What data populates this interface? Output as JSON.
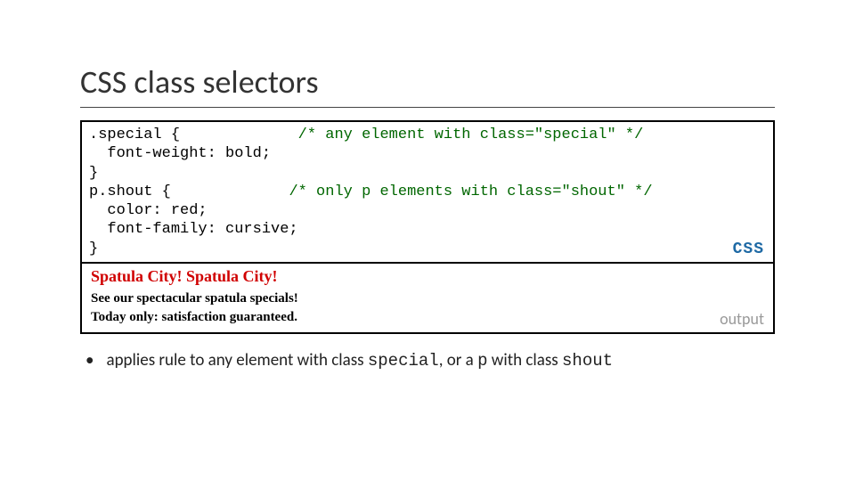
{
  "title": "CSS class selectors",
  "code": {
    "line1_sel": ".special",
    "line1_rest": " {",
    "line1_comment": "/* any element with class=\"special\" */",
    "line2": "  font-weight: bold;",
    "line3": "}",
    "line4_sel": "p.shout",
    "line4_rest": " {",
    "line4_comment": "/* only p elements with class=\"shout\" */",
    "line5": "  color: red;",
    "line6": "  font-family: cursive;",
    "line7": "}",
    "label": "CSS"
  },
  "output": {
    "shout": "Spatula City! Spatula City!",
    "line2": "See our spectacular spatula specials!",
    "line3": "Today only: satisfaction guaranteed.",
    "label": "output"
  },
  "bullet": {
    "t1": "applies rule to any element with class ",
    "c1": "special",
    "t2": ", or a ",
    "c2": "p",
    "t3": " with class ",
    "c3": "shout"
  }
}
